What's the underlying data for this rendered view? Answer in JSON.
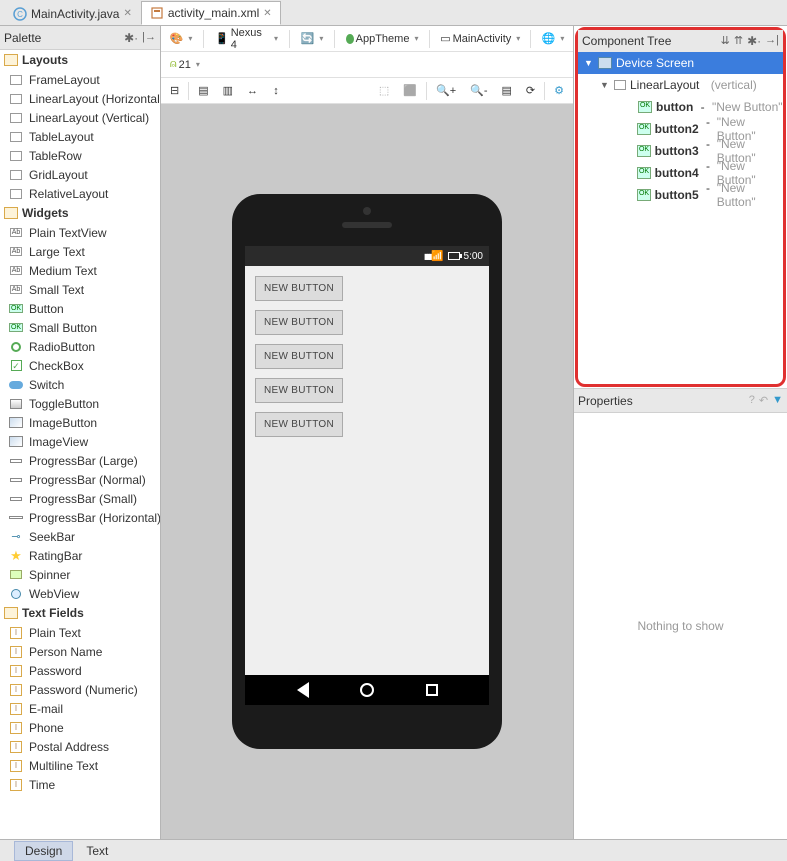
{
  "tabs": [
    {
      "label": "MainActivity.java",
      "icon_color": "#5a9fd4",
      "active": false
    },
    {
      "label": "activity_main.xml",
      "icon_color": "#c47a3f",
      "active": true
    }
  ],
  "palette": {
    "title": "Palette",
    "groups": {
      "layouts": {
        "label": "Layouts",
        "items": [
          "FrameLayout",
          "LinearLayout (Horizontal)",
          "LinearLayout (Vertical)",
          "TableLayout",
          "TableRow",
          "GridLayout",
          "RelativeLayout"
        ]
      },
      "widgets": {
        "label": "Widgets",
        "items": [
          "Plain TextView",
          "Large Text",
          "Medium Text",
          "Small Text",
          "Button",
          "Small Button",
          "RadioButton",
          "CheckBox",
          "Switch",
          "ToggleButton",
          "ImageButton",
          "ImageView",
          "ProgressBar (Large)",
          "ProgressBar (Normal)",
          "ProgressBar (Small)",
          "ProgressBar (Horizontal)",
          "SeekBar",
          "RatingBar",
          "Spinner",
          "WebView"
        ]
      },
      "textfields": {
        "label": "Text Fields",
        "items": [
          "Plain Text",
          "Person Name",
          "Password",
          "Password (Numeric)",
          "E-mail",
          "Phone",
          "Postal Address",
          "Multiline Text",
          "Time"
        ]
      }
    }
  },
  "toolbar": {
    "device": "Nexus 4",
    "theme": "AppTheme",
    "activity": "MainActivity",
    "api": "21"
  },
  "phone": {
    "time": "5:00",
    "buttons": [
      "NEW BUTTON",
      "NEW BUTTON",
      "NEW BUTTON",
      "NEW BUTTON",
      "NEW BUTTON"
    ]
  },
  "component_tree": {
    "title": "Component Tree",
    "root": {
      "label": "Device Screen"
    },
    "linear": {
      "label": "LinearLayout",
      "orientation": "(vertical)"
    },
    "buttons": [
      {
        "id": "button",
        "text": "\"New Button\""
      },
      {
        "id": "button2",
        "text": "\"New Button\""
      },
      {
        "id": "button3",
        "text": "\"New Button\""
      },
      {
        "id": "button4",
        "text": "\"New Button\""
      },
      {
        "id": "button5",
        "text": "\"New Button\""
      }
    ]
  },
  "properties": {
    "title": "Properties",
    "empty": "Nothing to show"
  },
  "footer": {
    "design": "Design",
    "text": "Text"
  }
}
